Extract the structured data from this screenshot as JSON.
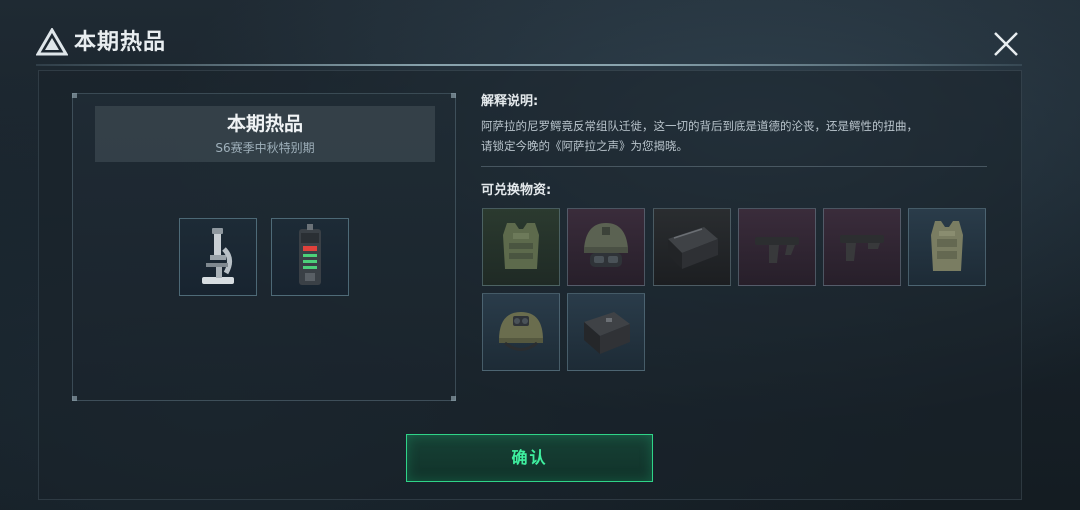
{
  "header": {
    "title": "本期热品",
    "logo_icon": "triangle-logo-icon",
    "close_icon": "close-icon"
  },
  "left_card": {
    "title": "本期热品",
    "subtitle": "S6赛季中秋特别期",
    "prizes": [
      {
        "icon": "microscope-icon"
      },
      {
        "icon": "device-icon"
      }
    ]
  },
  "explanation": {
    "heading": "解释说明:",
    "lines": [
      "阿萨拉的尼罗鳄竟反常组队迁徙，这一切的背后到底是道德的沦丧，还是鳄性的扭曲，",
      "请锁定今晚的《阿萨拉之声》为您揭晓。"
    ]
  },
  "exchange": {
    "heading": "可兑换物资:",
    "items": [
      {
        "icon": "body-armor-icon",
        "rarity": "green"
      },
      {
        "icon": "tactical-helmet-icon",
        "rarity": "purple"
      },
      {
        "icon": "ammo-case-icon",
        "rarity": "black"
      },
      {
        "icon": "foregrip-icon",
        "rarity": "purple"
      },
      {
        "icon": "foregrip-icon",
        "rarity": "purple"
      },
      {
        "icon": "body-armor-icon",
        "rarity": "blue"
      },
      {
        "icon": "night-vision-helmet-icon",
        "rarity": "blue"
      },
      {
        "icon": "ammo-case-icon",
        "rarity": "blue"
      }
    ]
  },
  "confirm_button": {
    "label": "确认"
  },
  "colors": {
    "accent_green": "#3ff0a0",
    "panel_border": "#7896a5",
    "rarity_green": "#2b3a2f",
    "rarity_purple": "#3a2c3b",
    "rarity_blue": "#2a3c4a"
  }
}
